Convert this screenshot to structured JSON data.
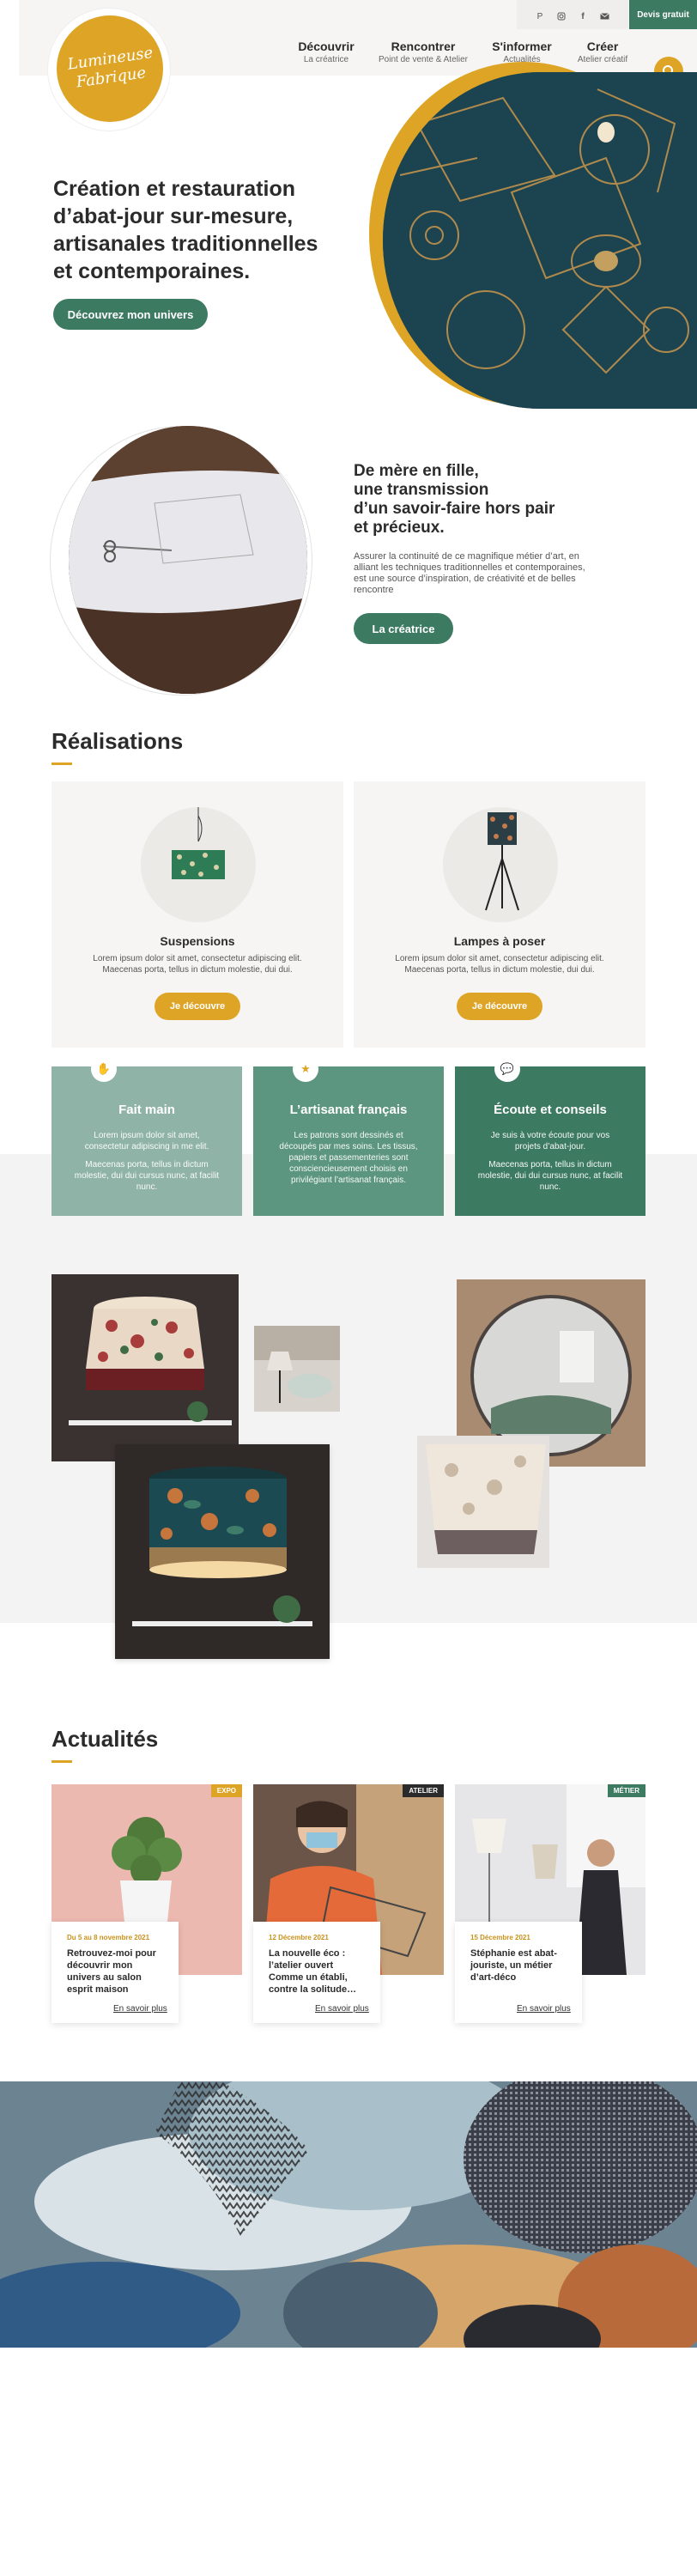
{
  "brand": {
    "logo_text": "Lumineuse Fabrique",
    "gold": "#dea426",
    "green": "#3d7a62"
  },
  "topbar": {
    "social_icons": [
      "pinterest-icon",
      "instagram-icon",
      "facebook-icon",
      "mail-icon"
    ],
    "cta_label": "Devis gratuit"
  },
  "nav": [
    {
      "title": "Découvrir",
      "sub": "La créatrice"
    },
    {
      "title": "Rencontrer",
      "sub": "Point de vente & Atelier"
    },
    {
      "title": "S'informer",
      "sub": "Actualités"
    },
    {
      "title": "Créer",
      "sub": "Atelier créatif"
    }
  ],
  "hero": {
    "heading": "Création et restauration d’abat-jour sur-mesure, artisanales traditionnelles et contemporaines.",
    "button": "Découvrez mon univers"
  },
  "about": {
    "heading_line1": "De mère en fille,",
    "heading_line2": "une transmission",
    "heading_line3": "d’un savoir-faire hors pair",
    "heading_line4": "et précieux.",
    "text": "Assurer la continuité de ce magnifique métier d’art, en alliant les techniques traditionnelles et contemporaines, est une source d’inspiration, de créativité et de belles rencontre",
    "button": "La créatrice"
  },
  "realisations": {
    "title": "Réalisations",
    "cards": [
      {
        "title": "Suspensions",
        "text": "Lorem ipsum dolor sit amet, consectetur adipiscing elit. Maecenas porta, tellus in dictum molestie, dui dui.",
        "button": "Je découvre"
      },
      {
        "title": "Lampes à poser",
        "text": "Lorem ipsum dolor sit amet, consectetur adipiscing elit. Maecenas porta, tellus in dictum molestie, dui dui.",
        "button": "Je découvre"
      }
    ]
  },
  "features": [
    {
      "title": "Fait main",
      "text1": "Lorem ipsum dolor sit amet, consectetur adipiscing in me elit.",
      "text2": "Maecenas porta, tellus in dictum molestie, dui dui cursus nunc, at facilit nunc.",
      "color": "#8fb3a6",
      "icon": "hand-icon"
    },
    {
      "title": "L’artisanat français",
      "text1": "Les patrons sont dessinés et découpés par mes soins. Les tissus, papiers et passementeries sont consciencieusement choisis en privilégiant l’artisanat français.",
      "text2": "",
      "color": "#5c9580",
      "icon": "badge-icon"
    },
    {
      "title": "Écoute et conseils",
      "text1": "Je suis à votre écoute pour vos projets d’abat-jour.",
      "text2": "Maecenas porta, tellus in dictum molestie, dui dui cursus nunc, at facilit nunc.",
      "color": "#3d7a62",
      "icon": "chat-icon"
    }
  ],
  "news": {
    "title": "Actualités",
    "items": [
      {
        "tag": "EXPO",
        "tag_color": "#dea426",
        "date": "Du 5 au 8 novembre 2021",
        "title": "Retrouvez-moi pour découvrir mon univers au salon esprit maison",
        "link": "En savoir plus"
      },
      {
        "tag": "ATELIER",
        "tag_color": "#2b2b2b",
        "date": "12 Décembre 2021",
        "title": "La nouvelle éco : l’atelier ouvert Comme un établi, contre la solitude…",
        "link": "En savoir plus"
      },
      {
        "tag": "MÉTIER",
        "tag_color": "#3d7a62",
        "date": "15 Décembre 2021",
        "title": "Stéphanie est abat-jouriste, un métier d’art-déco",
        "link": "En savoir plus"
      }
    ]
  }
}
